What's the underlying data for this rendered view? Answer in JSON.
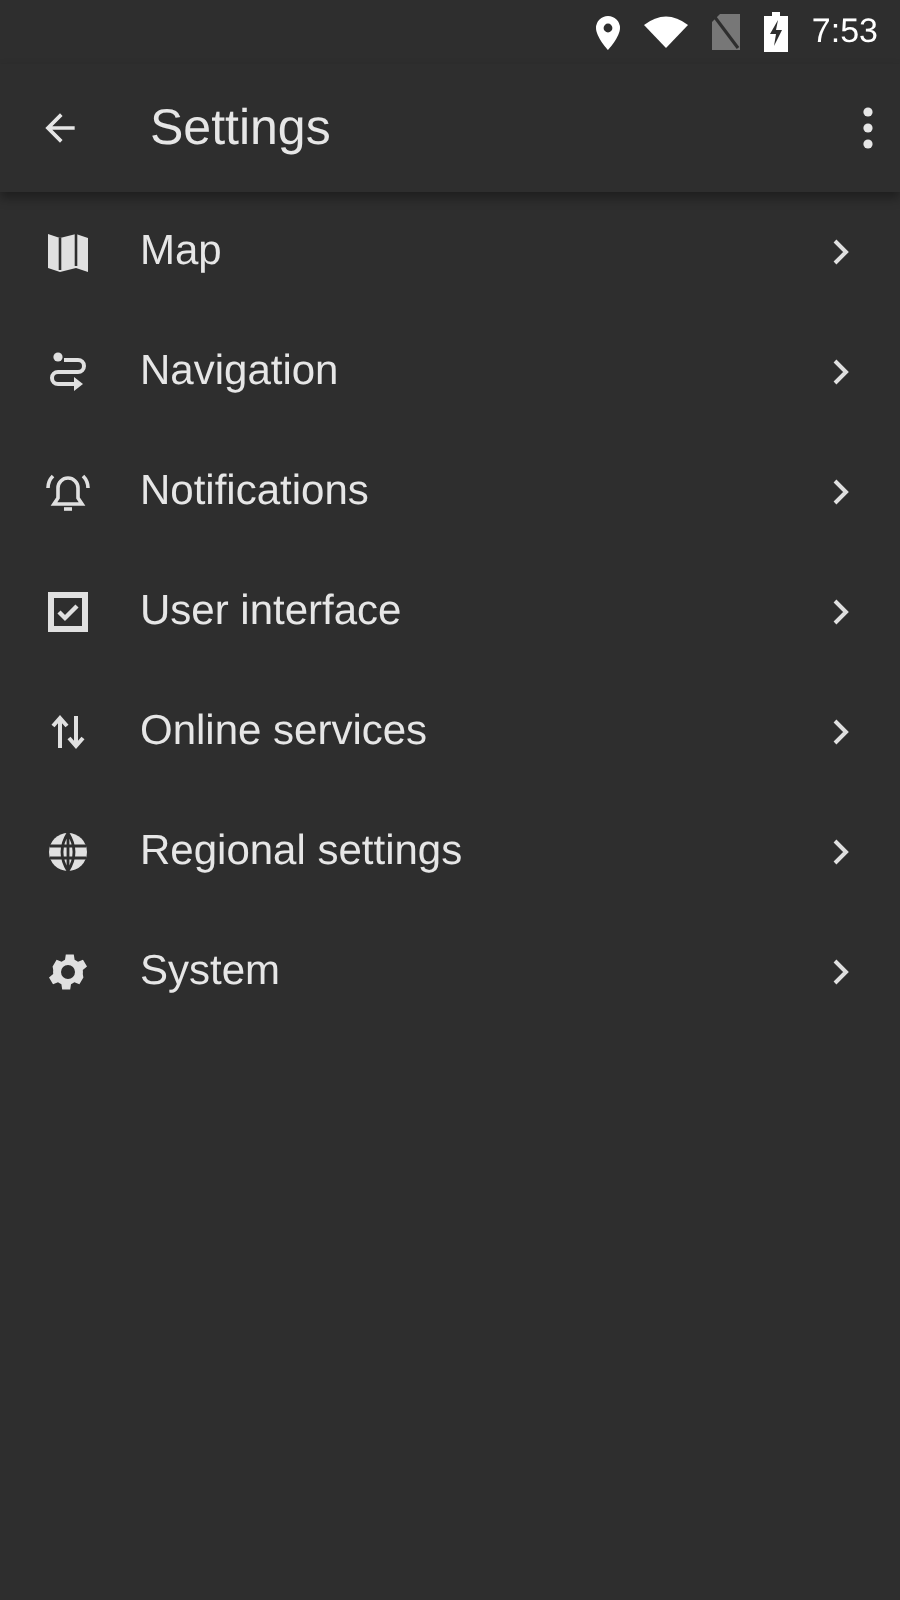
{
  "status_bar": {
    "time": "7:53"
  },
  "toolbar": {
    "title": "Settings"
  },
  "items": [
    {
      "kind": "map",
      "label": "Map"
    },
    {
      "kind": "route",
      "label": "Navigation"
    },
    {
      "kind": "bell",
      "label": "Notifications"
    },
    {
      "kind": "checkbox",
      "label": "User interface"
    },
    {
      "kind": "arrows",
      "label": "Online services"
    },
    {
      "kind": "globe",
      "label": "Regional settings"
    },
    {
      "kind": "gear",
      "label": "System"
    }
  ]
}
